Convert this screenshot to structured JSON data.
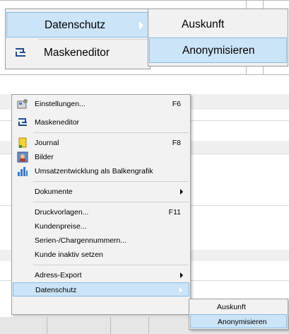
{
  "zoomed": {
    "menu": [
      {
        "label": "Datenschutz",
        "highlighted": true,
        "has_submenu": true
      },
      {
        "label": "Maskeneditor",
        "icon": "mask-editor-icon",
        "highlighted": false
      }
    ],
    "submenu": [
      {
        "label": "Auskunft",
        "highlighted": false
      },
      {
        "label": "Anonymisieren",
        "highlighted": true
      }
    ]
  },
  "context_menu": {
    "items": [
      {
        "label": "Einstellungen...",
        "shortcut": "F6",
        "icon": "settings-icon"
      },
      {
        "label": "Maskeneditor",
        "shortcut": "",
        "icon": "mask-editor-icon"
      },
      {
        "label": "Journal",
        "shortcut": "F8",
        "icon": "journal-icon"
      },
      {
        "label": "Bilder",
        "shortcut": "",
        "icon": "images-icon"
      },
      {
        "label": "Umsatzentwicklung als Balkengrafik",
        "shortcut": "",
        "icon": "bar-chart-icon"
      },
      {
        "label": "Dokumente",
        "shortcut": "",
        "has_submenu": true
      },
      {
        "label": "Druckvorlagen...",
        "shortcut": "F11"
      },
      {
        "label": "Kundenpreise..."
      },
      {
        "label": "Serien-/Chargennummern..."
      },
      {
        "label": "Kunde inaktiv setzen"
      },
      {
        "label": "Adress-Export",
        "has_submenu": true
      },
      {
        "label": "Datenschutz",
        "has_submenu": true,
        "highlighted": true
      }
    ],
    "submenu": [
      {
        "label": "Auskunft",
        "highlighted": false
      },
      {
        "label": "Anonymisieren",
        "highlighted": true
      }
    ]
  },
  "colors": {
    "highlight": "#cce4f7",
    "highlight_border": "#8ab9e6",
    "menu_bg": "#f2f2f2"
  }
}
